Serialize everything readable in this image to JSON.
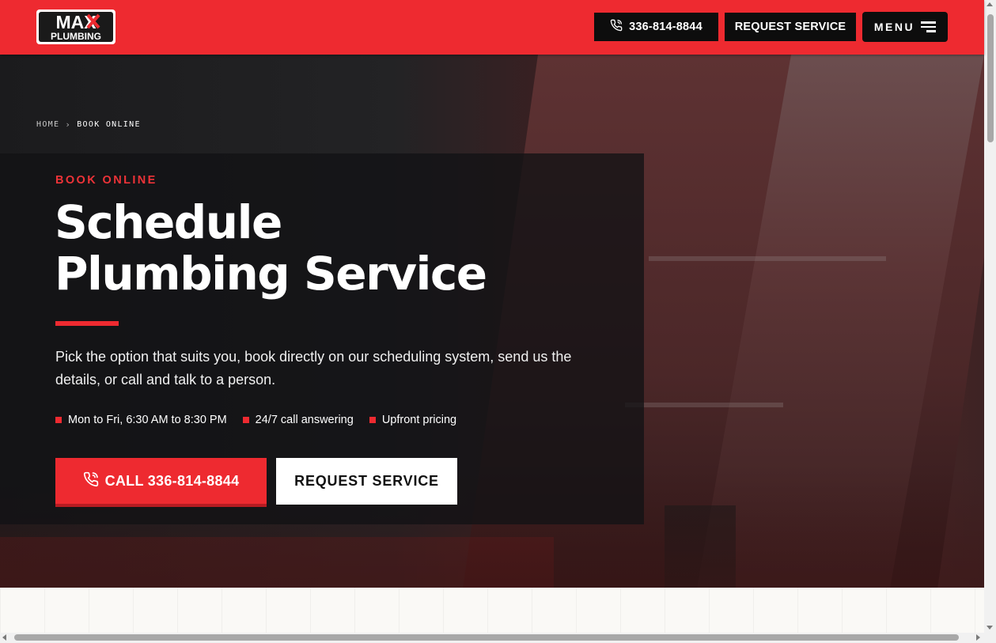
{
  "header": {
    "logo_top": "MAX",
    "logo_bottom": "PLUMBING",
    "phone_label": "336-814-8844",
    "request_label": "REQUEST SERVICE",
    "menu_label": "MENU"
  },
  "breadcrumb": {
    "home": "HOME",
    "separator": "›",
    "current": "BOOK ONLINE"
  },
  "hero": {
    "eyebrow": "BOOK ONLINE",
    "title_line1": "Schedule",
    "title_line2": "Plumbing Service",
    "description": "Pick the option that suits you, book directly on our scheduling system, send us the details, or call and talk to a person.",
    "features": [
      "Mon to Fri, 6:30 AM to 8:30 PM",
      "24/7 call answering",
      "Upfront pricing"
    ],
    "call_button": "CALL 336-814-8844",
    "request_button": "REQUEST SERVICE"
  },
  "icons": {
    "phone": "phone-icon",
    "menu": "hamburger-icon",
    "breadcrumb_separator": "chevron-right-icon"
  },
  "colors": {
    "brand_red": "#ee2a30",
    "dark": "#0d0d0d",
    "white": "#ffffff"
  }
}
